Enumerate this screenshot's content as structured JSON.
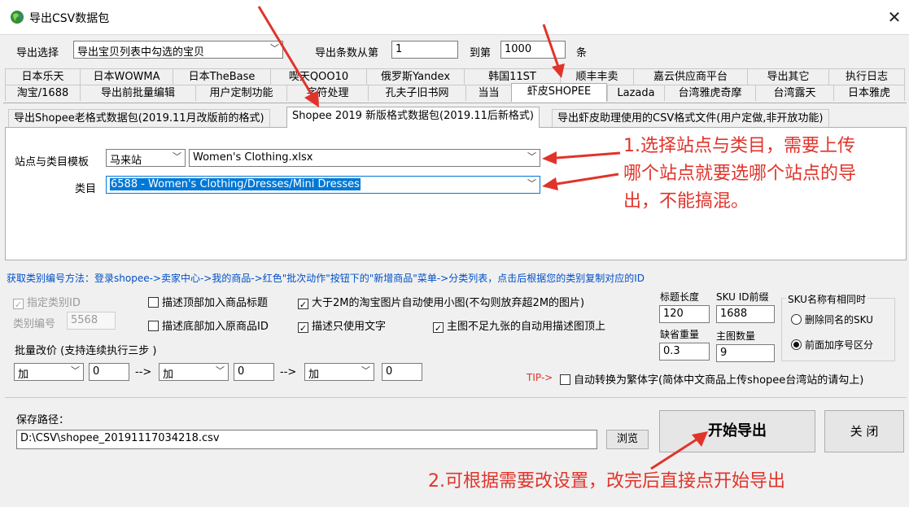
{
  "window": {
    "title": "导出CSV数据包",
    "close_glyph": "✕"
  },
  "export_select": {
    "label": "导出选择",
    "value": "导出宝贝列表中勾选的宝贝"
  },
  "range": {
    "from_label": "导出条数从第",
    "from_value": "1",
    "to_label": "到第",
    "to_value": "1000",
    "unit": "条"
  },
  "tabs_row1": [
    "日本乐天",
    "日本WOWMA",
    "日本TheBase",
    "喫天QOO10",
    "俄罗斯Yandex",
    "韩国11ST",
    "顺丰丰卖",
    "嘉云供应商平台",
    "导出其它",
    "执行日志"
  ],
  "tabs_row2": [
    "淘宝/1688",
    "导出前批量编辑",
    "用户定制功能",
    "字符处理",
    "孔夫子旧书网",
    "当当",
    "虾皮SHOPEE",
    "Lazada",
    "台湾雅虎奇摩",
    "台湾露天",
    "日本雅虎"
  ],
  "subtabs": [
    "导出Shopee老格式数据包(2019.11月改版前的格式)",
    "Shopee 2019 新版格式数据包(2019.11后新格式)",
    "导出虾皮助理使用的CSV格式文件(用户定做,非开放功能)"
  ],
  "site": {
    "label": "站点与类目模板",
    "site_value": "马来站",
    "template_value": "Women's Clothing.xlsx"
  },
  "category": {
    "label": "类目",
    "value": "6588 - Women's Clothing/Dresses/Mini Dresses"
  },
  "annotation1": {
    "line1": "1.选择站点与类目，需要上传",
    "line2": "哪个站点就要选哪个站点的导",
    "line3": "出，不能搞混。"
  },
  "category_id_help": "获取类别编号方法：登录shopee->卖家中心->我的商品->红色\"批次动作\"按钮下的\"新增商品\"菜单->分类列表，点击后根据您的类别复制对应的ID",
  "options": {
    "specify_category": {
      "label": "指定类别ID",
      "checked": true
    },
    "category_no_label": "类别编号",
    "category_no_value": "5568",
    "top_title": {
      "label": "描述顶部加入商品标题",
      "checked": false
    },
    "bottom_id": {
      "label": "描述底部加入原商品ID",
      "checked": false
    },
    "big_image": {
      "label": "大于2M的淘宝图片自动使用小图(不勾则放弃超2M的图片)",
      "checked": true
    },
    "text_only": {
      "label": "描述只使用文字",
      "checked": true
    },
    "main_image_fill": {
      "label": "主图不足九张的自动用描述图顶上",
      "checked": true
    }
  },
  "fields": {
    "title_len_label": "标题长度",
    "title_len_value": "120",
    "sku_prefix_label": "SKU ID前缀",
    "sku_prefix_value": "1688",
    "default_weight_label": "缺省重量",
    "default_weight_value": "0.3",
    "main_image_count_label": "主图数量",
    "main_image_count_value": "9"
  },
  "sku_group": {
    "title": "SKU名称有相同时",
    "opt1": "删除同名的SKU",
    "opt2": "前面加序号区分",
    "selected": "opt2"
  },
  "batch_price": {
    "label": "批量改价 (支持连续执行三步 )",
    "op1": "加",
    "val1": "0",
    "op2": "加",
    "val2": "0",
    "op3": "加",
    "val3": "0",
    "arrow": "-->"
  },
  "tip": {
    "prefix": "TIP->",
    "label": "自动转换为繁体字(简体中文商品上传shopee台湾站的请勾上)",
    "checked": false
  },
  "save": {
    "label": "保存路径：",
    "path": "D:\\CSV\\shopee_20191117034218.csv",
    "browse": "浏览"
  },
  "buttons": {
    "start": "开始导出",
    "close": "关 闭"
  },
  "annotation2": "2.可根据需要改设置，改完后直接点开始导出",
  "colors": {
    "annotation": "#e0342b",
    "help_text": "#0050c8",
    "tip": "#e0342b",
    "highlight": "#0078d7"
  }
}
